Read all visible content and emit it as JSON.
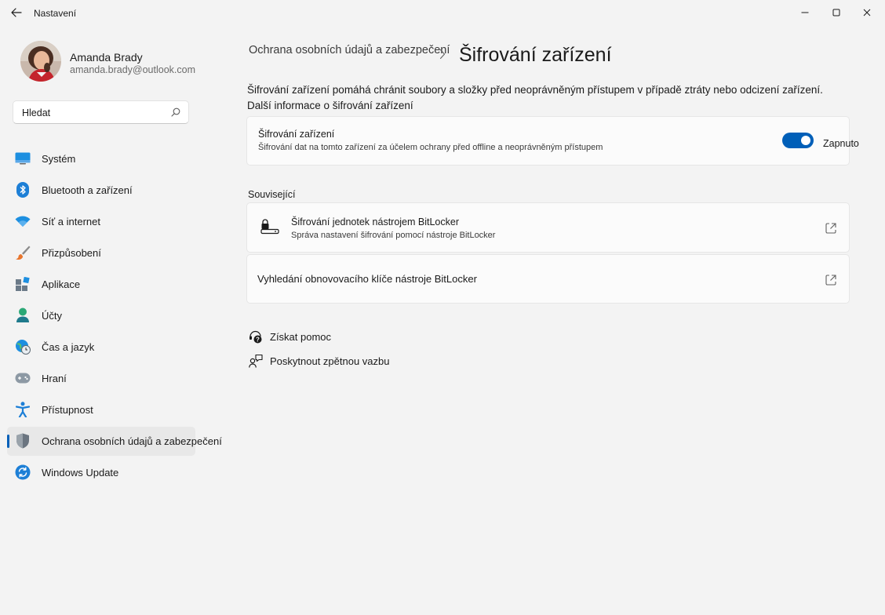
{
  "titlebar": {
    "app_title": "Nastavení",
    "back_icon": "arrow-left-icon",
    "minimize_icon": "minimize-icon",
    "maximize_icon": "maximize-icon",
    "close_icon": "close-icon"
  },
  "user": {
    "name": "Amanda Brady",
    "email": "amanda.brady@outlook.com"
  },
  "search": {
    "value": "",
    "placeholder": "Hledat",
    "icon": "search-icon"
  },
  "sidebar": {
    "items": [
      {
        "label": "Systém",
        "icon": "monitor-icon",
        "active": false
      },
      {
        "label": "Bluetooth a zařízení",
        "icon": "bluetooth-icon",
        "active": false
      },
      {
        "label": "Síť a internet",
        "icon": "wifi-icon",
        "active": false
      },
      {
        "label": "Přizpůsobení",
        "icon": "brush-icon",
        "active": false
      },
      {
        "label": "Aplikace",
        "icon": "apps-icon",
        "active": false
      },
      {
        "label": "Účty",
        "icon": "person-icon",
        "active": false
      },
      {
        "label": "Čas a jazyk",
        "icon": "globe-clock-icon",
        "active": false
      },
      {
        "label": "Hraní",
        "icon": "gamepad-icon",
        "active": false
      },
      {
        "label": "Přístupnost",
        "icon": "accessibility-icon",
        "active": false
      },
      {
        "label": "Ochrana osobních údajů a zabezpečení",
        "icon": "shield-icon",
        "active": true
      },
      {
        "label": "Windows Update",
        "icon": "sync-icon",
        "active": false
      }
    ]
  },
  "breadcrumb": {
    "parent": "Ochrana osobních údajů a zabezpečení",
    "separator_icon": "chevron-right-icon",
    "current": "Šifrování zařízení"
  },
  "description": {
    "text": "Šifrování zařízení pomáhá chránit soubory a složky před neoprávněným přístupem v případě ztráty nebo odcizení zařízení. ",
    "link": "Další informace o šifrování zařízení"
  },
  "encryption_card": {
    "title": "Šifrování zařízení",
    "subtitle": "Šifrování dat na tomto zařízení za účelem ochrany před offline a neoprávněným přístupem",
    "toggle_state": "Zapnuto",
    "toggle_on": true,
    "accent": "#005fb8"
  },
  "related": {
    "label": "Související",
    "items": [
      {
        "title": "Šifrování jednotek nástrojem BitLocker",
        "subtitle": "Správa nastavení šifrování pomocí nástroje BitLocker",
        "icon": "bitlocker-drive-icon",
        "link_icon": "open-external-icon"
      },
      {
        "title": "Vyhledání obnovovacího klíče nástroje BitLocker",
        "link_icon": "open-external-icon"
      }
    ]
  },
  "help": {
    "get_help": "Získat pomoc",
    "get_help_icon": "help-chat-icon",
    "feedback": "Poskytnout zpětnou vazbu",
    "feedback_icon": "feedback-icon"
  }
}
